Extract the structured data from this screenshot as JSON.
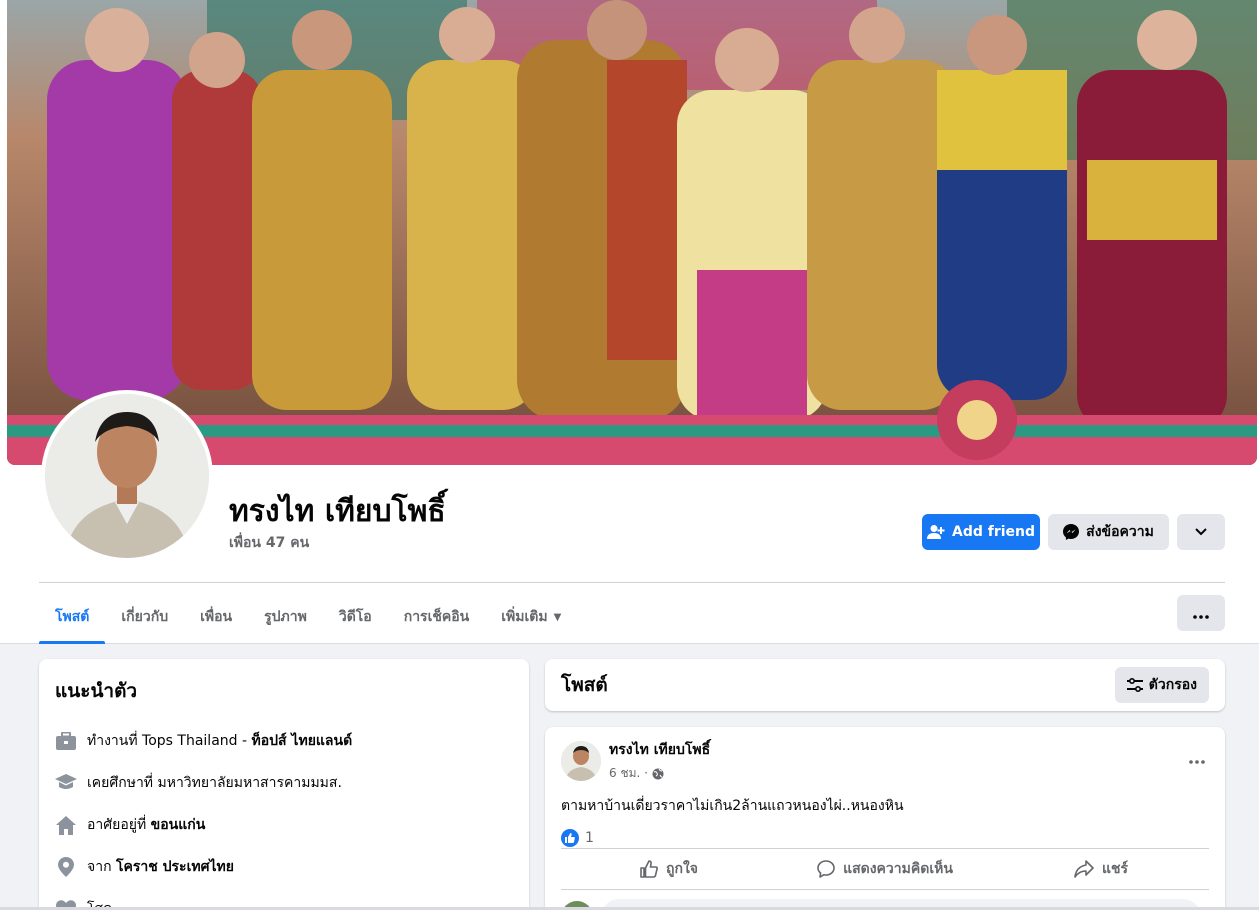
{
  "profile": {
    "name": "ทรงไท เทียบโพธิ์",
    "friends": "เพื่อน 47 คน"
  },
  "actions": {
    "add_friend": "Add friend",
    "message": "ส่งข้อความ"
  },
  "tabs": [
    {
      "label": "โพสต์",
      "active": true
    },
    {
      "label": "เกี่ยวกับ"
    },
    {
      "label": "เพื่อน"
    },
    {
      "label": "รูปภาพ"
    },
    {
      "label": "วิดีโอ"
    },
    {
      "label": "การเช็คอิน"
    },
    {
      "label": "เพิ่มเติม"
    }
  ],
  "intro": {
    "title": "แนะนำตัว",
    "work_prefix": "ทำงานที่ Tops Thailand - ",
    "work_bold": "ท็อปส์ ไทยแลนด์",
    "education": "เคยศึกษาที่ มหาวิทยาลัยมหาสารคามมมส.",
    "lives_prefix": "อาศัยอยู่ที่ ",
    "lives_bold": "ขอนแก่น",
    "from_prefix": "จาก ",
    "from_bold": "โคราช ประเทศไทย",
    "relationship": "โสด"
  },
  "posts_section": {
    "title": "โพสต์",
    "filter_label": "ตัวกรอง"
  },
  "post": {
    "author": "ทรงไท เทียบโพธิ์",
    "time": "6 ชม. ·",
    "text": "ตามหาบ้านเดี่ยวราคาไม่เกิน2ล้านแถวหนองไผ่..หนองหิน",
    "like_count": "1",
    "like_label": "ถูกใจ",
    "comment_label": "แสดงความคิดเห็น",
    "share_label": "แชร์"
  },
  "colors": {
    "accent": "#1877f2",
    "background": "#f0f2f5",
    "secondary_text": "#65676b"
  }
}
